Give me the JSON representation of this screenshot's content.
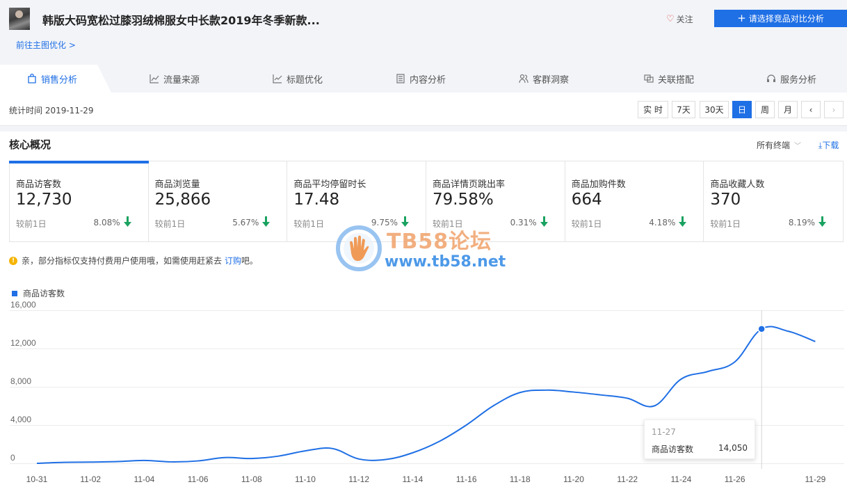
{
  "header": {
    "product_title": "韩版大码宽松过膝羽绒棉服女中长款2019年冬季新款...",
    "follow_label": "关注",
    "compare_label": "请选择竞品对比分析",
    "optimize_link": "前往主图优化 >"
  },
  "tabs": [
    {
      "label": "销售分析",
      "icon": "bag-icon",
      "active": true
    },
    {
      "label": "流量来源",
      "icon": "line-chart-icon"
    },
    {
      "label": "标题优化",
      "icon": "trend-icon"
    },
    {
      "label": "内容分析",
      "icon": "document-icon"
    },
    {
      "label": "客群洞察",
      "icon": "users-icon"
    },
    {
      "label": "关联搭配",
      "icon": "link-icon"
    },
    {
      "label": "服务分析",
      "icon": "headset-icon"
    }
  ],
  "datebar": {
    "stat_time": "统计时间 2019-11-29",
    "buttons": [
      {
        "label": "实 时"
      },
      {
        "label": "7天"
      },
      {
        "label": "30天"
      },
      {
        "label": "日",
        "active": true
      },
      {
        "label": "周"
      },
      {
        "label": "月"
      },
      {
        "label": "‹"
      },
      {
        "label": "›",
        "disabled": true
      }
    ]
  },
  "core": {
    "title": "核心概况",
    "terminal_select": "所有终端",
    "download": "下载",
    "compare_label": "较前1日",
    "metrics": [
      {
        "label": "商品访客数",
        "value": "12,730",
        "pct": "8.08%",
        "trend": "down"
      },
      {
        "label": "商品浏览量",
        "value": "25,866",
        "pct": "5.67%",
        "trend": "down"
      },
      {
        "label": "商品平均停留时长",
        "value": "17.48",
        "pct": "9.75%",
        "trend": "down"
      },
      {
        "label": "商品详情页跳出率",
        "value": "79.58%",
        "pct": "0.31%",
        "trend": "down"
      },
      {
        "label": "商品加购件数",
        "value": "664",
        "pct": "4.18%",
        "trend": "down"
      },
      {
        "label": "商品收藏人数",
        "value": "370",
        "pct": "8.19%",
        "trend": "down"
      }
    ]
  },
  "notice": {
    "text_before": "亲，部分指标仅支持付费用户使用哦，如需使用赶紧去 ",
    "link": "订购",
    "text_after": "吧。"
  },
  "watermark": {
    "line1": "TB58论坛",
    "line2": "www.tb58.net"
  },
  "tooltip": {
    "date": "11-27",
    "name": "商品访客数",
    "value": "14,050"
  },
  "colors": {
    "accent": "#1f6fe5",
    "down_arrow": "#1aa260",
    "warn": "#f5b400"
  },
  "chart_data": {
    "type": "line",
    "series": [
      {
        "name": "商品访客数"
      }
    ],
    "y_ticks": [
      "16,000",
      "12,000",
      "8,000",
      "4,000",
      "0"
    ],
    "x_ticks": [
      "10-31",
      "11-02",
      "11-04",
      "11-06",
      "11-08",
      "11-10",
      "11-12",
      "11-14",
      "11-16",
      "11-18",
      "11-20",
      "11-22",
      "11-24",
      "11-26",
      "11-29"
    ],
    "ylim": [
      0,
      16000
    ],
    "grid": true,
    "x": [
      "10-31",
      "11-01",
      "11-02",
      "11-03",
      "11-04",
      "11-05",
      "11-06",
      "11-07",
      "11-08",
      "11-09",
      "11-10",
      "11-11",
      "11-12",
      "11-13",
      "11-14",
      "11-15",
      "11-16",
      "11-17",
      "11-18",
      "11-19",
      "11-20",
      "11-21",
      "11-22",
      "11-23",
      "11-24",
      "11-25",
      "11-26",
      "11-27",
      "11-28",
      "11-29"
    ],
    "values": [
      0,
      100,
      130,
      180,
      300,
      150,
      250,
      600,
      500,
      750,
      1300,
      1550,
      450,
      400,
      1100,
      2300,
      4000,
      6000,
      7400,
      7650,
      7450,
      7150,
      6800,
      6000,
      8800,
      9600,
      10600,
      14050,
      13800,
      12730
    ],
    "highlight": "11-27"
  }
}
